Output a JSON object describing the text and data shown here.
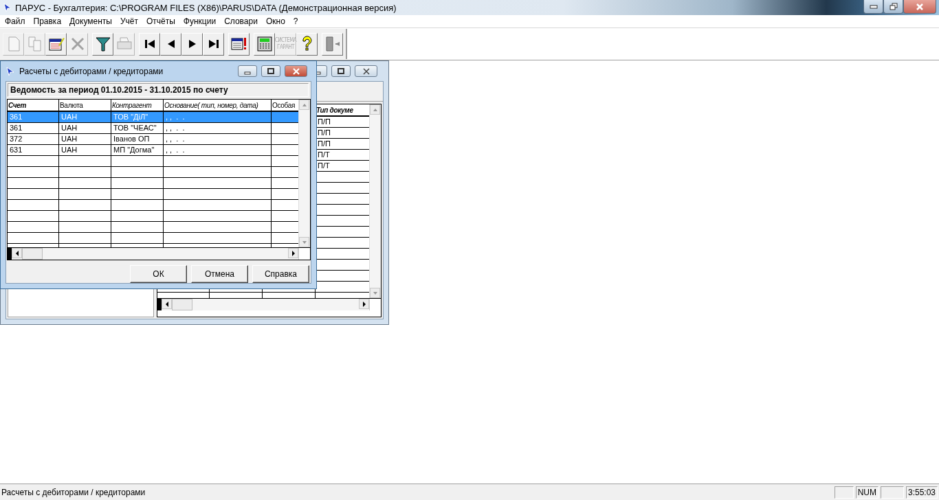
{
  "window": {
    "title": "ПАРУС - Бухгалтерия: C:\\PROGRAM FILES (X86)\\PARUS\\DATA (Демонстрационная версия)"
  },
  "menu": [
    "Файл",
    "Правка",
    "Документы",
    "Учёт",
    "Отчёты",
    "Функции",
    "Словари",
    "Окно",
    "?"
  ],
  "toolbar": [
    [
      {
        "kind": "new",
        "disabled": true
      },
      {
        "kind": "copy",
        "disabled": true
      },
      {
        "kind": "edit",
        "disabled": false
      },
      {
        "kind": "delete",
        "disabled": true
      }
    ],
    [
      {
        "kind": "filter",
        "disabled": false
      },
      {
        "kind": "print",
        "disabled": true
      }
    ],
    [
      {
        "kind": "first",
        "disabled": false
      },
      {
        "kind": "prev",
        "disabled": false
      },
      {
        "kind": "next",
        "disabled": false
      },
      {
        "kind": "last",
        "disabled": false
      }
    ],
    [
      {
        "kind": "calendar-alert",
        "disabled": false
      }
    ],
    [
      {
        "kind": "calculator",
        "disabled": false
      },
      {
        "kind": "garant",
        "disabled": true,
        "label": [
          "СИСТЕМА",
          "ГАРАНТ"
        ]
      },
      {
        "kind": "help",
        "disabled": false
      }
    ],
    [
      {
        "kind": "exit",
        "disabled": false
      }
    ]
  ],
  "back_window": {
    "grid": {
      "column_header": "Тип докуме",
      "cells": [
        "П/П",
        "П/П",
        "П/П",
        "П/Т",
        "П/Т"
      ]
    }
  },
  "dialog": {
    "title": "Расчеты с дебиторами / кредиторами",
    "heading": "Ведомость за период 01.10.2015 - 31.10.2015 по счету",
    "columns": [
      {
        "label": "Счет",
        "kind": "bold-italic"
      },
      {
        "label": "Валюта",
        "kind": "plain"
      },
      {
        "label": "Контрагент",
        "kind": "italic"
      },
      {
        "label": "Основание( тип, номер, дата)",
        "kind": "italic"
      },
      {
        "label": "Особая",
        "kind": "plain"
      }
    ],
    "rows": [
      {
        "account": "361",
        "currency": "UAH",
        "counterparty": "ТОВ \"ДіЛ\"",
        "basis": ", ,  .  .",
        "selected": true
      },
      {
        "account": "361",
        "currency": "UAH",
        "counterparty": "ТОВ \"ЧЕАС\"",
        "basis": ", ,  .  .",
        "selected": false
      },
      {
        "account": "372",
        "currency": "UAH",
        "counterparty": "Іванов ОП",
        "basis": ", ,  .  .",
        "selected": false
      },
      {
        "account": "631",
        "currency": "UAH",
        "counterparty": "МП \"Догма\"",
        "basis": ", ,  .  .",
        "selected": false
      }
    ],
    "buttons": [
      "ОК",
      "Отмена",
      "Справка"
    ]
  },
  "status_bar": {
    "text": "Расчеты с дебиторами / кредиторами",
    "indicator": "NUM",
    "clock": "3:55:03"
  }
}
